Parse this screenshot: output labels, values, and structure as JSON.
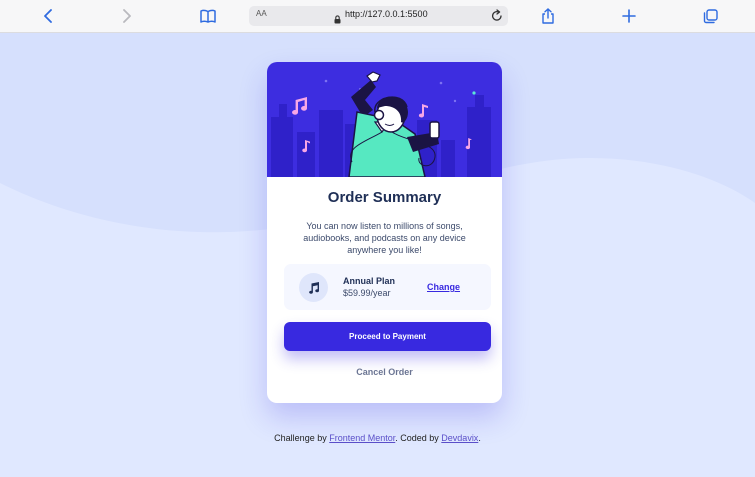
{
  "browser": {
    "text_size_label": "AA",
    "url": "http://127.0.0.1:5500"
  },
  "card": {
    "title": "Order Summary",
    "description": "You can now listen to millions of songs, audiobooks, and podcasts on any device anywhere you like!",
    "plan": {
      "name": "Annual Plan",
      "price": "$59.99/year",
      "change_label": "Change"
    },
    "proceed_label": "Proceed to Payment",
    "cancel_label": "Cancel Order"
  },
  "footer": {
    "prefix": "Challenge by ",
    "link1": "Frontend Mentor",
    "middle": ". Coded by ",
    "link2": "Devdavix",
    "suffix": "."
  },
  "colors": {
    "accent": "#3829e0",
    "page_bg": "#e0e8ff",
    "wave": "#d6e0fd",
    "title": "#1f2f56"
  }
}
